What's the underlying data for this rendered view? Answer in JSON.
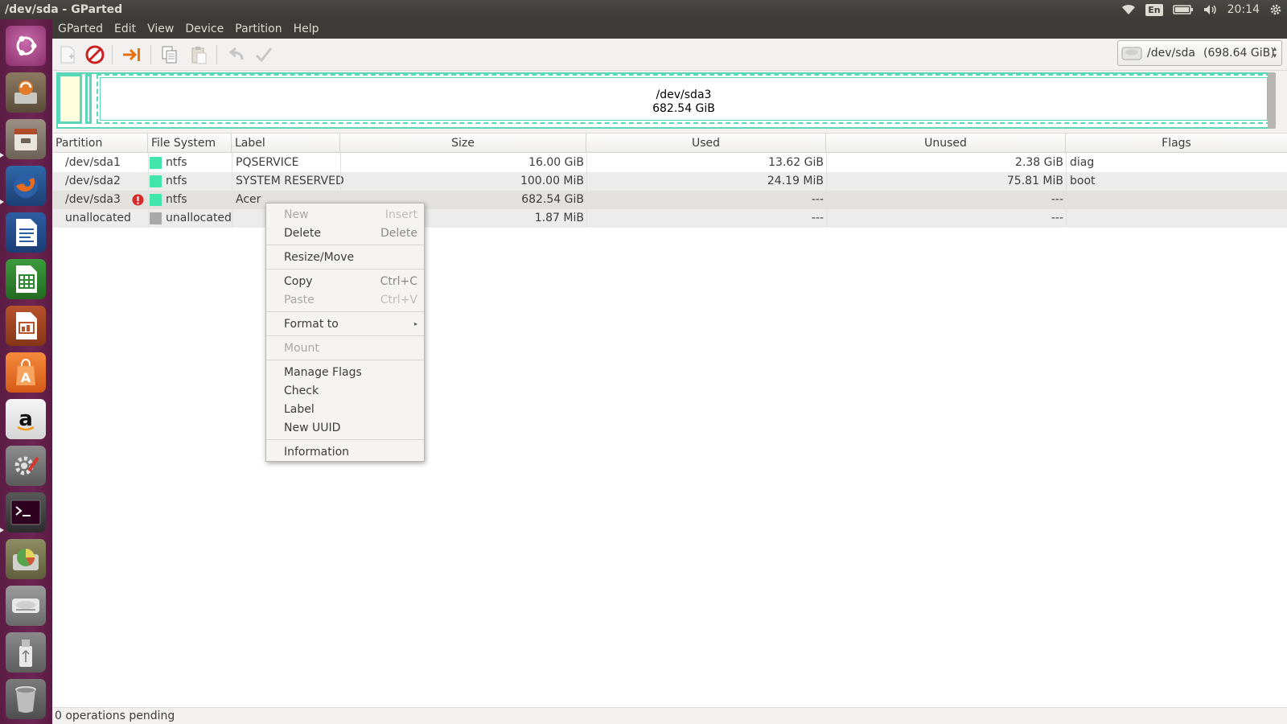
{
  "window": {
    "title": "/dev/sda - GParted"
  },
  "panel": {
    "keyboard_layout": "En",
    "clock": "20:14",
    "icons": [
      "wifi-icon",
      "keyboard-icon",
      "battery-icon",
      "volume-icon",
      "settings-gear-icon"
    ]
  },
  "launcher": {
    "items": [
      "ubuntu-dash",
      "software-updater",
      "files",
      "firefox",
      "libreoffice-writer",
      "libreoffice-calc",
      "libreoffice-impress",
      "ubuntu-software-center",
      "amazon",
      "system-settings",
      "terminal",
      "gparted",
      "disk-drive",
      "usb-drive",
      "trash"
    ]
  },
  "menubar": {
    "items": [
      "GParted",
      "Edit",
      "View",
      "Device",
      "Partition",
      "Help"
    ]
  },
  "toolbar": {
    "buttons": [
      "new-icon",
      "delete-icon",
      "resize-move-icon",
      "copy-icon",
      "paste-icon",
      "undo-icon",
      "apply-icon"
    ],
    "device_name": "/dev/sda",
    "device_size": "(698.64 GiB)"
  },
  "disk_graphic": {
    "selected_name": "/dev/sda3",
    "selected_size": "682.54 GiB",
    "accent": "#5ad6b8"
  },
  "table": {
    "headers": [
      "Partition",
      "File System",
      "Label",
      "Size",
      "Used",
      "Unused",
      "Flags"
    ],
    "rows": [
      {
        "partition": "/dev/sda1",
        "fs": "ntfs",
        "fs_color": "#42e5ac",
        "label": "PQSERVICE",
        "size": "16.00 GiB",
        "used": "13.62 GiB",
        "unused": "2.38 GiB",
        "flags": "diag",
        "warning": false
      },
      {
        "partition": "/dev/sda2",
        "fs": "ntfs",
        "fs_color": "#42e5ac",
        "label": "SYSTEM RESERVED",
        "size": "100.00 MiB",
        "used": "24.19 MiB",
        "unused": "75.81 MiB",
        "flags": "boot",
        "warning": false
      },
      {
        "partition": "/dev/sda3",
        "fs": "ntfs",
        "fs_color": "#42e5ac",
        "label": "Acer",
        "size": "682.54 GiB",
        "used": "---",
        "unused": "---",
        "flags": "",
        "warning": true
      },
      {
        "partition": "unallocated",
        "fs": "unallocated",
        "fs_color": "#a9a9a9",
        "label": "",
        "size": "1.87 MiB",
        "used": "---",
        "unused": "---",
        "flags": "",
        "warning": false
      }
    ]
  },
  "context_menu": {
    "items": [
      {
        "label": "New",
        "accel": "Insert",
        "enabled": false
      },
      {
        "label": "Delete",
        "accel": "Delete",
        "enabled": true
      },
      {
        "label": "Resize/Move",
        "accel": "",
        "enabled": true
      },
      {
        "label": "Copy",
        "accel": "Ctrl+C",
        "enabled": true
      },
      {
        "label": "Paste",
        "accel": "Ctrl+V",
        "enabled": false
      },
      {
        "label": "Format to",
        "accel": "",
        "enabled": true,
        "submenu": true
      },
      {
        "label": "Mount",
        "accel": "",
        "enabled": false
      },
      {
        "label": "Manage Flags",
        "accel": "",
        "enabled": true
      },
      {
        "label": "Check",
        "accel": "",
        "enabled": true
      },
      {
        "label": "Label",
        "accel": "",
        "enabled": true
      },
      {
        "label": "New UUID",
        "accel": "",
        "enabled": true
      },
      {
        "label": "Information",
        "accel": "",
        "enabled": true
      }
    ]
  },
  "statusbar": {
    "text": "0 operations pending"
  }
}
